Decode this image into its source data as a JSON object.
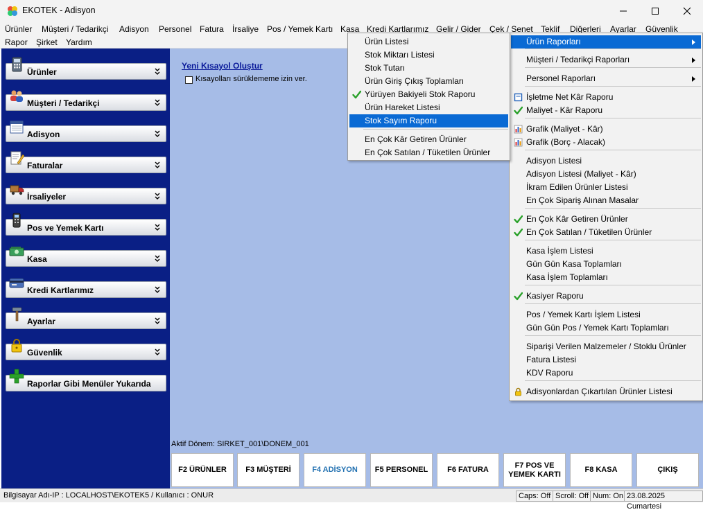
{
  "window": {
    "title": "EKOTEK - Adisyon"
  },
  "menubar": {
    "items": [
      "Ürünler",
      "Müşteri / Tedarikçi",
      "Adisyon",
      "Personel",
      "Fatura",
      "İrsaliye",
      "Pos / Yemek Kartı",
      "Kasa",
      "Kredi Kartlarımız",
      "Gelir / Gider",
      "Çek / Senet",
      "Teklif",
      "Diğerleri",
      "Ayarlar",
      "Güvenlik",
      "Rapor",
      "Şirket",
      "Yardım"
    ]
  },
  "sidebar": {
    "items": [
      {
        "label": "Ürünler",
        "icon": "calculator-icon"
      },
      {
        "label": "Müşteri / Tedarikçi",
        "icon": "users-icon"
      },
      {
        "label": "Adisyon",
        "icon": "calendar-icon"
      },
      {
        "label": "Faturalar",
        "icon": "invoice-icon"
      },
      {
        "label": "İrsaliyeler",
        "icon": "truck-icon"
      },
      {
        "label": "Pos ve Yemek Kartı",
        "icon": "pos-terminal-icon"
      },
      {
        "label": "Kasa",
        "icon": "cash-icon"
      },
      {
        "label": "Kredi Kartlarımız",
        "icon": "credit-card-icon"
      },
      {
        "label": "Ayarlar",
        "icon": "hammer-icon"
      },
      {
        "label": "Güvenlik",
        "icon": "lock-icon"
      },
      {
        "label": "Raporlar Gibi Menüler Yukarıda",
        "icon": "plus-icon"
      }
    ]
  },
  "content": {
    "new_shortcut": "Yeni Kısayol Oluştur",
    "drag_label": "Kısayolları sürüklememe izin ver.",
    "period": "Aktif Dönem:   SIRKET_001\\DONEM_001"
  },
  "fkeys": [
    {
      "label": "F2 ÜRÜNLER"
    },
    {
      "label": "F3 MÜŞTERİ"
    },
    {
      "label": "F4 ADİSYON"
    },
    {
      "label": "F5 PERSONEL"
    },
    {
      "label": "F6 FATURA"
    },
    {
      "label": "F7 POS VE\nYEMEK KARTI"
    },
    {
      "label": "F8 KASA"
    },
    {
      "label": "ÇIKIŞ"
    }
  ],
  "status": {
    "left": "Bilgisayar Adı-IP : LOCALHOST\\EKOTEK5 / Kullanıcı : ONUR",
    "caps": "Caps: Off",
    "scroll": "Scroll: Off",
    "num": "Num: On",
    "date": "23.08.2025 Cumartesi"
  },
  "rapor_menu": {
    "items": [
      {
        "label": "Ürün Raporları",
        "icon": "",
        "submenu": true,
        "highlighted": true
      },
      {
        "label": "Müşteri / Tedarikçi Raporları",
        "icon": "",
        "submenu": true
      },
      {
        "label": "Personel Raporları",
        "icon": "",
        "submenu": true
      },
      {
        "label": "İşletme Net Kâr Raporu",
        "icon": "report-icon"
      },
      {
        "label": "Maliyet - Kâr Raporu",
        "icon": "check-icon"
      },
      {
        "label": "Grafik (Maliyet - Kâr)",
        "icon": "bar-chart-icon"
      },
      {
        "label": "Grafik (Borç - Alacak)",
        "icon": "bar-chart-icon"
      },
      {
        "label": "Adisyon Listesi",
        "icon": ""
      },
      {
        "label": "Adisyon Listesi (Maliyet - Kâr)",
        "icon": ""
      },
      {
        "label": "İkram Edilen Ürünler Listesi",
        "icon": ""
      },
      {
        "label": "En Çok Sipariş Alınan Masalar",
        "icon": ""
      },
      {
        "label": "En Çok Kâr Getiren Ürünler",
        "icon": "check-icon"
      },
      {
        "label": "En Çok Satılan / Tüketilen Ürünler",
        "icon": "check-icon"
      },
      {
        "label": "Kasa İşlem Listesi",
        "icon": ""
      },
      {
        "label": "Gün Gün Kasa Toplamları",
        "icon": ""
      },
      {
        "label": "Kasa İşlem Toplamları",
        "icon": ""
      },
      {
        "label": "Kasiyer Raporu",
        "icon": "check-icon"
      },
      {
        "label": "Pos / Yemek Kartı İşlem Listesi",
        "icon": ""
      },
      {
        "label": "Gün Gün Pos / Yemek Kartı Toplamları",
        "icon": ""
      },
      {
        "label": "Siparişi Verilen Malzemeler / Stoklu Ürünler",
        "icon": ""
      },
      {
        "label": "Fatura Listesi",
        "icon": ""
      },
      {
        "label": "KDV Raporu",
        "icon": ""
      },
      {
        "label": "Adisyonlardan Çıkartılan Ürünler Listesi",
        "icon": "lock-icon"
      }
    ]
  },
  "urun_menu": {
    "items": [
      {
        "label": "Ürün Listesi",
        "icon": ""
      },
      {
        "label": "Stok Miktarı Listesi",
        "icon": ""
      },
      {
        "label": "Stok Tutarı",
        "icon": ""
      },
      {
        "label": "Ürün Giriş Çıkış Toplamları",
        "icon": ""
      },
      {
        "label": "Yürüyen Bakiyeli Stok Raporu",
        "icon": "check-icon"
      },
      {
        "label": "Ürün Hareket Listesi",
        "icon": ""
      },
      {
        "label": "Stok Sayım Raporu",
        "icon": "",
        "highlighted": true
      },
      {
        "label": "En Çok Kâr Getiren Ürünler",
        "icon": ""
      },
      {
        "label": "En Çok Satılan / Tüketilen Ürünler",
        "icon": ""
      }
    ]
  },
  "colors": {
    "sidebar_bg": "#0a1f85",
    "content_bg": "#a6bce7",
    "highlight": "#0a6ad4",
    "check": "#2aa12a"
  }
}
